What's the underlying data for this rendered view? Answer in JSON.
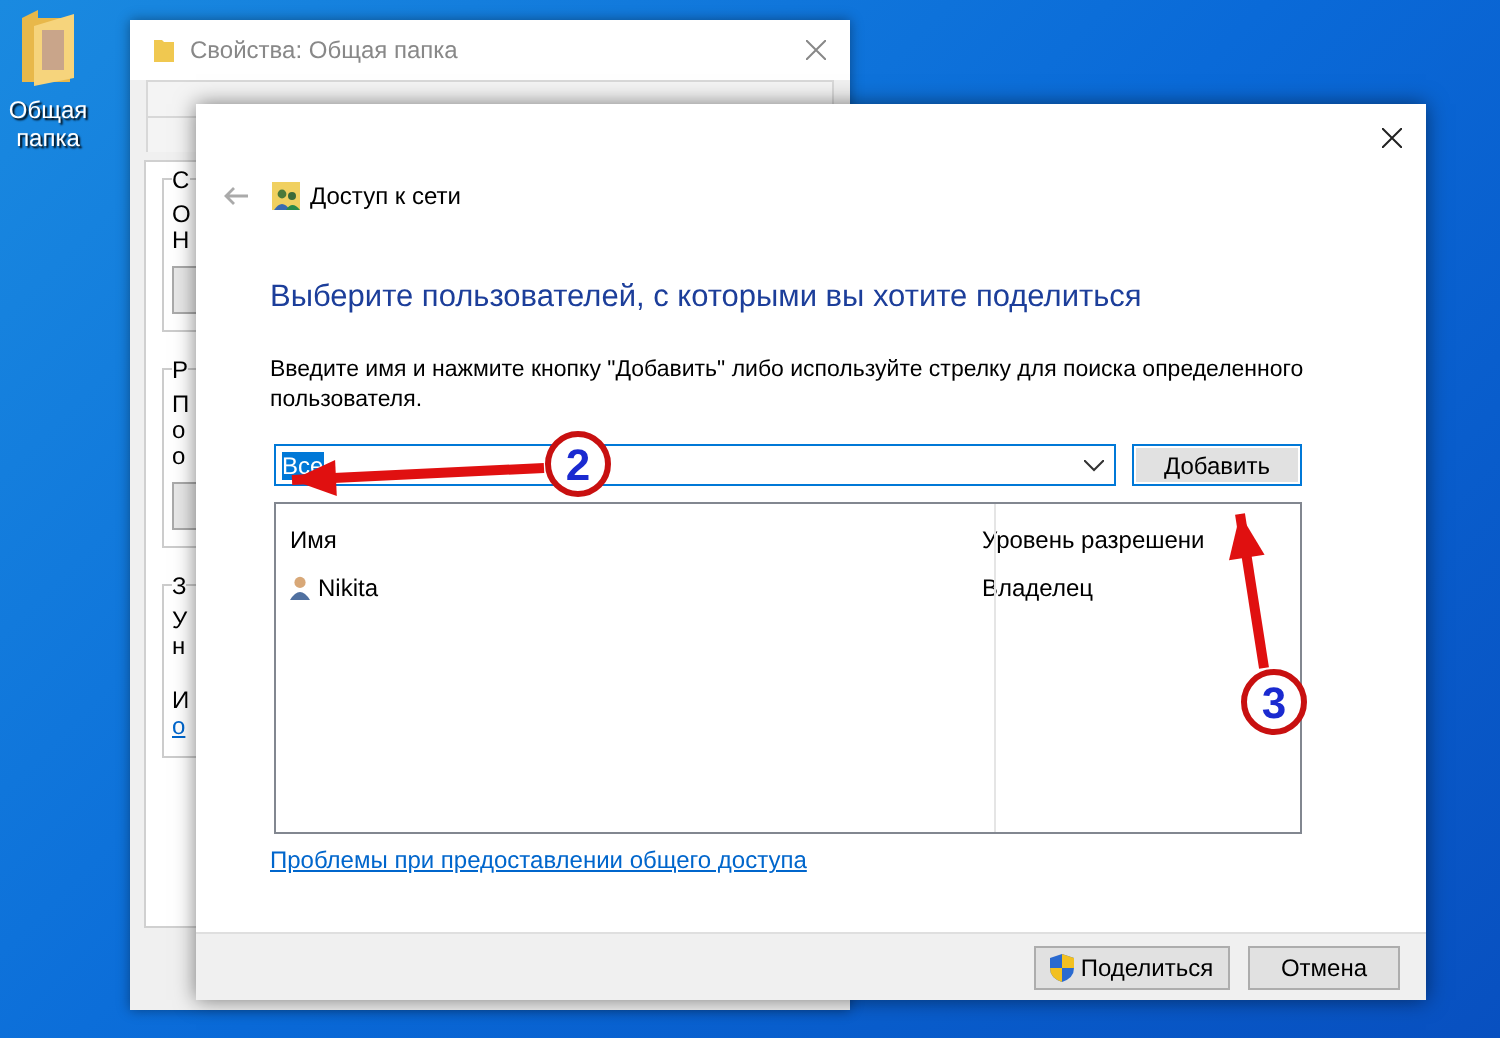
{
  "desktop_icon": {
    "label": "Общая папка"
  },
  "background_window": {
    "title": "Свойства: Общая папка",
    "groups": [
      {
        "legend": "С",
        "lines": [
          {
            "kind": "text",
            "text": "О"
          },
          {
            "kind": "text",
            "text": "Н"
          }
        ],
        "has_button": true
      },
      {
        "legend": "Р",
        "lines": [
          {
            "kind": "text",
            "text": "П"
          },
          {
            "kind": "text",
            "text": "о"
          },
          {
            "kind": "text",
            "text": "о"
          }
        ],
        "has_button": true
      },
      {
        "legend": "З",
        "lines": [
          {
            "kind": "text",
            "text": "У"
          },
          {
            "kind": "text",
            "text": "н"
          },
          {
            "kind": "gap"
          },
          {
            "kind": "text",
            "text": "И"
          },
          {
            "kind": "link",
            "text": "о"
          }
        ],
        "has_button": false
      }
    ]
  },
  "dialog": {
    "title": "Доступ к сети",
    "heading": "Выберите пользователей, с которыми вы хотите поделиться",
    "instruction": "Введите имя и нажмите кнопку \"Добавить\" либо используйте стрелку для поиска определенного пользователя.",
    "user_field": {
      "value": "Все",
      "selected": true
    },
    "add_button": "Добавить",
    "table": {
      "columns": [
        "Имя",
        "Уровень разрешени"
      ],
      "rows": [
        {
          "name": "Nikita",
          "permission": "Владелец"
        }
      ]
    },
    "help_link": "Проблемы при предоставлении общего доступа",
    "buttons": [
      {
        "label": "Поделиться",
        "kind": "shield"
      },
      {
        "label": "Отмена",
        "kind": "plain"
      }
    ]
  },
  "annotations": [
    {
      "label": "2"
    },
    {
      "label": "3"
    }
  ]
}
